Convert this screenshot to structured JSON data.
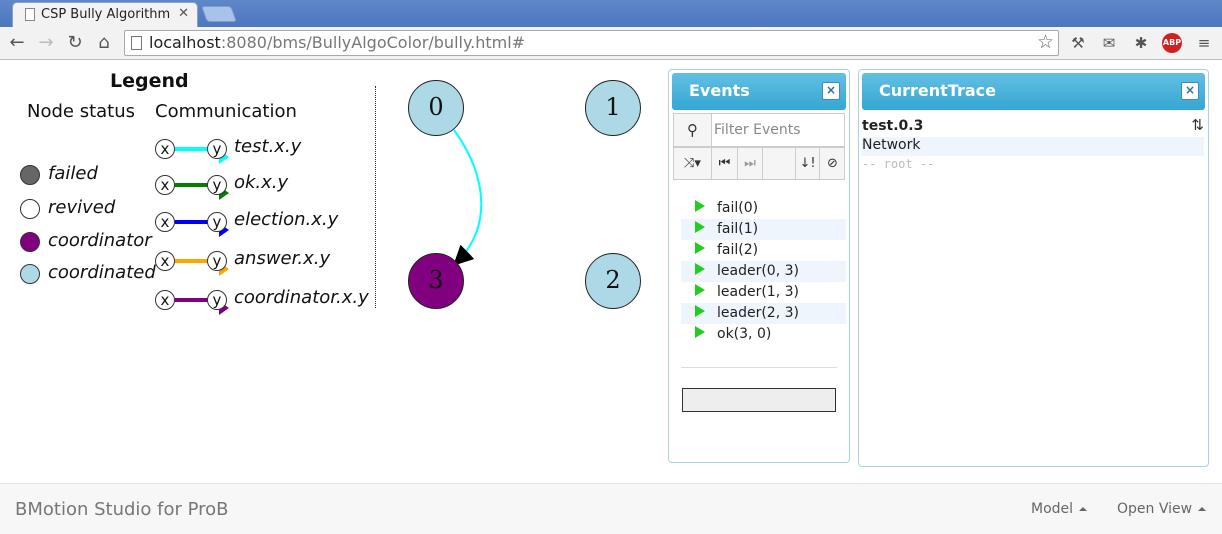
{
  "browser": {
    "tab_title": "CSP Bully Algorithm",
    "tab_close": "✕",
    "url_host": "localhost",
    "url_rest": ":8080/bms/BullyAlgoColor/bully.html#"
  },
  "legend": {
    "title": "Legend",
    "node_status_header": "Node status",
    "communication_header": "Communication",
    "statuses": [
      {
        "label": "failed",
        "color": "#666666"
      },
      {
        "label": "revived",
        "color": "#ffffff"
      },
      {
        "label": "coordinator",
        "color": "#800080"
      },
      {
        "label": "coordinated",
        "color": "#add8e6"
      }
    ],
    "communications": [
      {
        "x": "x",
        "y": "y",
        "label": "test.x.y",
        "color": "#00ffff"
      },
      {
        "x": "x",
        "y": "y",
        "label": "ok.x.y",
        "color": "#008000"
      },
      {
        "x": "x",
        "y": "y",
        "label": "election.x.y",
        "color": "#0000ff"
      },
      {
        "x": "x",
        "y": "y",
        "label": "answer.x.y",
        "color": "#ffa500"
      },
      {
        "x": "x",
        "y": "y",
        "label": "coordinator.x.y",
        "color": "#800080"
      }
    ]
  },
  "graph": {
    "nodes": [
      {
        "label": "0",
        "status": "coordinated",
        "color": "#add8e6"
      },
      {
        "label": "1",
        "status": "coordinated",
        "color": "#add8e6"
      },
      {
        "label": "2",
        "status": "coordinated",
        "color": "#add8e6"
      },
      {
        "label": "3",
        "status": "coordinator",
        "color": "#800080"
      }
    ],
    "edges": [
      {
        "from": "0",
        "to": "3",
        "type": "test",
        "color": "#00ffff"
      }
    ]
  },
  "events_panel": {
    "title": "Events",
    "close": "×",
    "filter_placeholder": "Filter Events",
    "events": [
      "fail(0)",
      "fail(1)",
      "fail(2)",
      "leader(0, 3)",
      "leader(1, 3)",
      "leader(2, 3)",
      "ok(3, 0)"
    ]
  },
  "trace_panel": {
    "title": "CurrentTrace",
    "close": "×",
    "trace_name": "test.0.3",
    "items": [
      "Network"
    ],
    "root_label": "-- root --"
  },
  "footer": {
    "brand": "BMotion Studio for ProB",
    "model_menu": "Model",
    "open_view_menu": "Open View"
  }
}
